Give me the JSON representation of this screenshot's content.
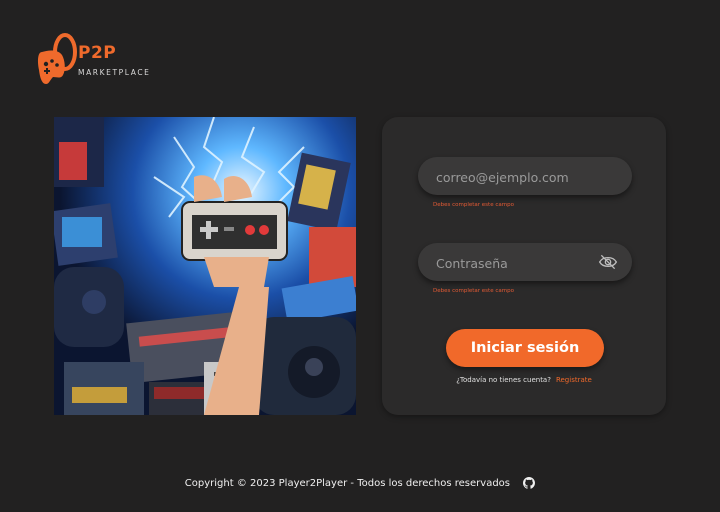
{
  "brand": {
    "name": "P2P",
    "subtitle": "MARKETPLACE",
    "accent": "#ef6a2c"
  },
  "hero": {
    "image": "retro-gaming-collage",
    "icon": "gamepad-lightning-illustration"
  },
  "login": {
    "email_placeholder": "correo@ejemplo.com",
    "email_error": "Debes completar este campo",
    "password_placeholder": "Contraseña",
    "password_error": "Debes completar este campo",
    "toggle_icon": "eye-off-icon",
    "submit_label": "Iniciar sesión",
    "signup_question": "¿Todavía no tienes cuenta?",
    "signup_link": "Registrate"
  },
  "footer": {
    "copyright": "Copyright © 2023 Player2Player - Todos los derechos reservados",
    "icon": "github-icon"
  },
  "colors": {
    "background": "#222121",
    "card": "#2b2a2a",
    "field": "#3a3939",
    "accent": "#f1692a",
    "error": "#e25a34"
  }
}
